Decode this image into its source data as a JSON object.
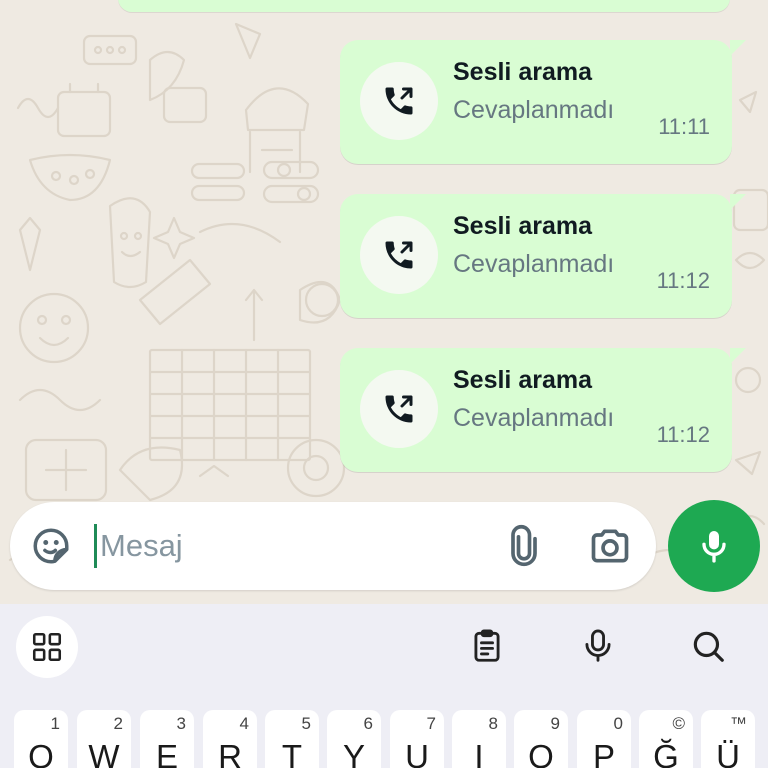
{
  "calls": [
    {
      "title": "Sesli arama",
      "status": "Cevaplanmadı",
      "time": "11:11"
    },
    {
      "title": "Sesli arama",
      "status": "Cevaplanmadı",
      "time": "11:12"
    },
    {
      "title": "Sesli arama",
      "status": "Cevaplanmadı",
      "time": "11:12"
    }
  ],
  "composer": {
    "placeholder": "Mesaj",
    "value": ""
  },
  "keyboard": {
    "keys": [
      {
        "letter": "Q",
        "hint": "1"
      },
      {
        "letter": "W",
        "hint": "2"
      },
      {
        "letter": "E",
        "hint": "3"
      },
      {
        "letter": "R",
        "hint": "4"
      },
      {
        "letter": "T",
        "hint": "5"
      },
      {
        "letter": "Y",
        "hint": "6"
      },
      {
        "letter": "U",
        "hint": "7"
      },
      {
        "letter": "I",
        "hint": "8"
      },
      {
        "letter": "O",
        "hint": "9"
      },
      {
        "letter": "P",
        "hint": "0"
      },
      {
        "letter": "Ğ",
        "hint": "©"
      },
      {
        "letter": "Ü",
        "hint": "™"
      }
    ]
  },
  "icons": {
    "call": "outgoing-call-icon",
    "sticker": "sticker-icon",
    "attach": "paperclip-icon",
    "camera": "camera-icon",
    "mic": "mic-icon",
    "apps": "grid-icon",
    "clipboard": "clipboard-icon",
    "voice": "mic-outline-icon",
    "search": "search-icon"
  },
  "colors": {
    "bubble": "#d9fdd3",
    "wallpaper": "#efeae2",
    "accent": "#1ea952",
    "muted_text": "#667781"
  }
}
